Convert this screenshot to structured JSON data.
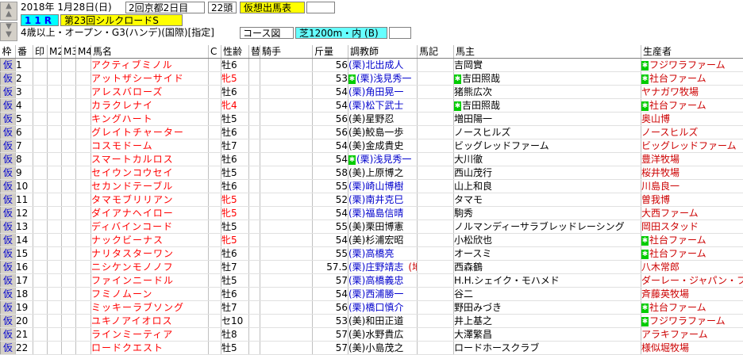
{
  "header": {
    "date": "2018年  1月28日(日)",
    "meeting": "2回京都2日目",
    "head_count": "22頭",
    "card_label": "仮想出馬表",
    "race_no": "11R",
    "race_name": "第23回シルクロードS",
    "conditions": "4歳以上・オープン・G3(ハンデ)(国際)[指定]",
    "course_label": "コース図",
    "course": "芝1200m・内 (B)"
  },
  "columns": [
    "枠",
    "番",
    "印",
    "M2",
    "M3",
    "M4",
    "馬名",
    "C",
    "性齢",
    "替",
    "騎手",
    "斤量",
    "調教師",
    "馬記",
    "馬主",
    "生産者"
  ],
  "rows": [
    {
      "waku": "仮",
      "ban": "1",
      "name": "アクティブミノル",
      "c": "",
      "sex": "牡6",
      "kae": "",
      "jockey": "",
      "weight": "56",
      "region": "(栗)",
      "trainer": "北出成人",
      "trainer_mark": "",
      "owner": "吉岡實",
      "owner_mark": "",
      "breeder": "フジワラファーム",
      "breeder_mark": true,
      "female": false
    },
    {
      "waku": "仮",
      "ban": "2",
      "name": "アットザシーサイド",
      "c": "",
      "sex": "牝5",
      "kae": "",
      "jockey": "",
      "weight": "53",
      "region": "(栗)",
      "trainer": "浅見秀一",
      "trainer_mark": true,
      "owner": "吉田照哉",
      "owner_mark": true,
      "breeder": "社台ファーム",
      "breeder_mark": true,
      "female": true
    },
    {
      "waku": "仮",
      "ban": "3",
      "name": "アレスバローズ",
      "c": "",
      "sex": "牡6",
      "kae": "",
      "jockey": "",
      "weight": "54",
      "region": "(栗)",
      "trainer": "角田晃一",
      "trainer_mark": false,
      "owner": "猪熊広次",
      "owner_mark": false,
      "breeder": "ヤナガワ牧場",
      "breeder_mark": false,
      "female": false
    },
    {
      "waku": "仮",
      "ban": "4",
      "name": "カラクレナイ",
      "c": "",
      "sex": "牝4",
      "kae": "",
      "jockey": "",
      "weight": "54",
      "region": "(栗)",
      "trainer": "松下武士",
      "trainer_mark": false,
      "owner": "吉田照哉",
      "owner_mark": true,
      "breeder": "社台ファーム",
      "breeder_mark": true,
      "female": true
    },
    {
      "waku": "仮",
      "ban": "5",
      "name": "キングハート",
      "c": "",
      "sex": "牡5",
      "kae": "",
      "jockey": "",
      "weight": "56",
      "region": "(美)",
      "trainer": "星野忍",
      "trainer_mark": false,
      "owner": "増田陽一",
      "owner_mark": false,
      "breeder": "奥山博",
      "breeder_mark": false,
      "female": false
    },
    {
      "waku": "仮",
      "ban": "6",
      "name": "グレイトチャーター",
      "c": "",
      "sex": "牡6",
      "kae": "",
      "jockey": "",
      "weight": "56",
      "region": "(美)",
      "trainer": "鮫島一歩",
      "trainer_mark": false,
      "owner": "ノースヒルズ",
      "owner_mark": false,
      "breeder": "ノースヒルズ",
      "breeder_mark": false,
      "female": false
    },
    {
      "waku": "仮",
      "ban": "7",
      "name": "コスモドーム",
      "c": "",
      "sex": "牡7",
      "kae": "",
      "jockey": "",
      "weight": "54",
      "region": "(美)",
      "trainer": "金成貴史",
      "trainer_mark": false,
      "owner": "ビッグレッドファーム",
      "owner_mark": false,
      "breeder": "ビッグレッドファーム",
      "breeder_mark": false,
      "female": false
    },
    {
      "waku": "仮",
      "ban": "8",
      "name": "スマートカルロス",
      "c": "",
      "sex": "牡6",
      "kae": "",
      "jockey": "",
      "weight": "54",
      "region": "(栗)",
      "trainer": "浅見秀一",
      "trainer_mark": true,
      "owner": "大川徹",
      "owner_mark": false,
      "breeder": "豊洋牧場",
      "breeder_mark": false,
      "female": false
    },
    {
      "waku": "仮",
      "ban": "9",
      "name": "セイウンコウセイ",
      "c": "",
      "sex": "牡5",
      "kae": "",
      "jockey": "",
      "weight": "58",
      "region": "(美)",
      "trainer": "上原博之",
      "trainer_mark": false,
      "owner": "西山茂行",
      "owner_mark": false,
      "breeder": "桜井牧場",
      "breeder_mark": false,
      "female": false
    },
    {
      "waku": "仮",
      "ban": "10",
      "name": "セカンドテーブル",
      "c": "",
      "sex": "牡6",
      "kae": "",
      "jockey": "",
      "weight": "55",
      "region": "(栗)",
      "trainer": "崎山博樹",
      "trainer_mark": false,
      "owner": "山上和良",
      "owner_mark": false,
      "breeder": "川島良一",
      "breeder_mark": false,
      "female": false
    },
    {
      "waku": "仮",
      "ban": "11",
      "name": "タマモブリリアン",
      "c": "",
      "sex": "牝5",
      "kae": "",
      "jockey": "",
      "weight": "52",
      "region": "(栗)",
      "trainer": "南井克巳",
      "trainer_mark": false,
      "owner": "タマモ",
      "owner_mark": false,
      "breeder": "曽我博",
      "breeder_mark": false,
      "female": true
    },
    {
      "waku": "仮",
      "ban": "12",
      "name": "ダイアナヘイロー",
      "c": "",
      "sex": "牝5",
      "kae": "",
      "jockey": "",
      "weight": "54",
      "region": "(栗)",
      "trainer": "福島信晴",
      "trainer_mark": false,
      "owner": "駒秀",
      "owner_mark": false,
      "breeder": "大西ファーム",
      "breeder_mark": false,
      "female": true
    },
    {
      "waku": "仮",
      "ban": "13",
      "name": "ディバインコード",
      "c": "",
      "sex": "牡5",
      "kae": "",
      "jockey": "",
      "weight": "55",
      "region": "(美)",
      "trainer": "栗田博憲",
      "trainer_mark": false,
      "owner": "ノルマンディーサラブレッドレーシング",
      "owner_mark": false,
      "breeder": "岡田スタッド",
      "breeder_mark": false,
      "female": false
    },
    {
      "waku": "仮",
      "ban": "14",
      "name": "ナックビーナス",
      "c": "",
      "sex": "牝5",
      "kae": "",
      "jockey": "",
      "weight": "54",
      "region": "(美)",
      "trainer": "杉浦宏昭",
      "trainer_mark": false,
      "owner": "小松欣也",
      "owner_mark": false,
      "breeder": "社台ファーム",
      "breeder_mark": true,
      "female": true
    },
    {
      "waku": "仮",
      "ban": "15",
      "name": "ナリタスターワン",
      "c": "",
      "sex": "牡6",
      "kae": "",
      "jockey": "",
      "weight": "55",
      "region": "(栗)",
      "trainer": "高橋亮",
      "trainer_mark": false,
      "owner": "オースミ",
      "owner_mark": false,
      "breeder": "社台ファーム",
      "breeder_mark": true,
      "female": false
    },
    {
      "waku": "仮",
      "ban": "16",
      "name": "ニシケンモノノフ",
      "c": "",
      "sex": "牡7",
      "kae": "",
      "jockey": "",
      "weight": "57.5",
      "region": "(栗)",
      "trainer": "庄野靖志",
      "trainer_mark": false,
      "trainer_extra": "(地)",
      "owner": "西森鶴",
      "owner_mark": false,
      "breeder": "八木常郎",
      "breeder_mark": false,
      "female": false
    },
    {
      "waku": "仮",
      "ban": "17",
      "name": "ファインニードル",
      "c": "",
      "sex": "牡5",
      "kae": "",
      "jockey": "",
      "weight": "57",
      "region": "(栗)",
      "trainer": "高橋義忠",
      "trainer_mark": false,
      "owner": "H.H.シェイク・モハメド",
      "owner_mark": false,
      "breeder": "ダーレー・ジャパン・ファーム",
      "breeder_mark": false,
      "female": false
    },
    {
      "waku": "仮",
      "ban": "18",
      "name": "フミノムーン",
      "c": "",
      "sex": "牡6",
      "kae": "",
      "jockey": "",
      "weight": "54",
      "region": "(栗)",
      "trainer": "西浦勝一",
      "trainer_mark": false,
      "owner": "谷二",
      "owner_mark": false,
      "breeder": "斉藤英牧場",
      "breeder_mark": false,
      "female": false
    },
    {
      "waku": "仮",
      "ban": "19",
      "name": "ミッキーラブソング",
      "c": "",
      "sex": "牡7",
      "kae": "",
      "jockey": "",
      "weight": "56",
      "region": "(栗)",
      "trainer": "橋口慎介",
      "trainer_mark": false,
      "owner": "野田みづき",
      "owner_mark": false,
      "breeder": "社台ファーム",
      "breeder_mark": true,
      "female": false
    },
    {
      "waku": "仮",
      "ban": "20",
      "name": "ユキノアイオロス",
      "c": "",
      "sex": "セ10",
      "kae": "",
      "jockey": "",
      "weight": "53",
      "region": "(美)",
      "trainer": "和田正道",
      "trainer_mark": false,
      "owner": "井上基之",
      "owner_mark": false,
      "breeder": "フジワラファーム",
      "breeder_mark": true,
      "female": false
    },
    {
      "waku": "仮",
      "ban": "21",
      "name": "ラインミーティア",
      "c": "",
      "sex": "牡8",
      "kae": "",
      "jockey": "",
      "weight": "57",
      "region": "(美)",
      "trainer": "水野貴広",
      "trainer_mark": false,
      "owner": "大澤繁昌",
      "owner_mark": false,
      "breeder": "アラキファーム",
      "breeder_mark": false,
      "female": false
    },
    {
      "waku": "仮",
      "ban": "22",
      "name": "ロードクエスト",
      "c": "",
      "sex": "牡5",
      "kae": "",
      "jockey": "",
      "weight": "57",
      "region": "(美)",
      "trainer": "小島茂之",
      "trainer_mark": false,
      "owner": "ロードホースクラブ",
      "owner_mark": false,
      "breeder": "様似堀牧場",
      "breeder_mark": false,
      "female": false
    }
  ],
  "icons": {
    "up": "up-arrow-icon",
    "down": "down-arrow-icon",
    "mark": "green-mark-icon"
  }
}
